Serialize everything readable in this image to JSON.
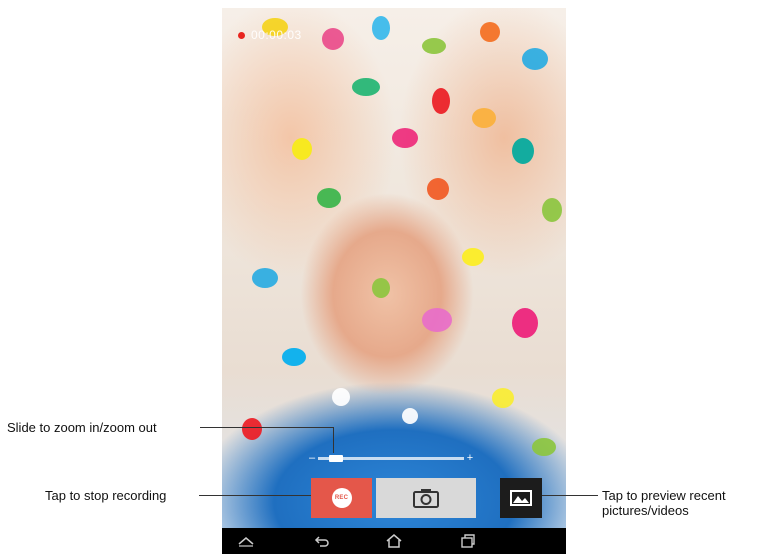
{
  "recording": {
    "time": "00:00:03"
  },
  "controls": {
    "rec_label": "REC",
    "zoom_minus": "–",
    "zoom_plus": "+",
    "zoom_level": 0.08
  },
  "callouts": {
    "zoom": "Slide to zoom in/zoom out",
    "stop": "Tap to stop recording",
    "preview_line1": "Tap to preview recent",
    "preview_line2": "pictures/videos"
  },
  "icons": {
    "camera": "camera-icon",
    "gallery": "gallery-icon",
    "nav_recents_apps": "chevron-up-icon",
    "nav_back": "back-icon",
    "nav_home": "home-icon",
    "nav_recent": "recent-apps-icon"
  },
  "colors": {
    "rec_button": "#e4574a",
    "rec_dot": "#e8251f",
    "photo_button": "#d9d9d9",
    "gallery_button": "#1c1c1c"
  }
}
